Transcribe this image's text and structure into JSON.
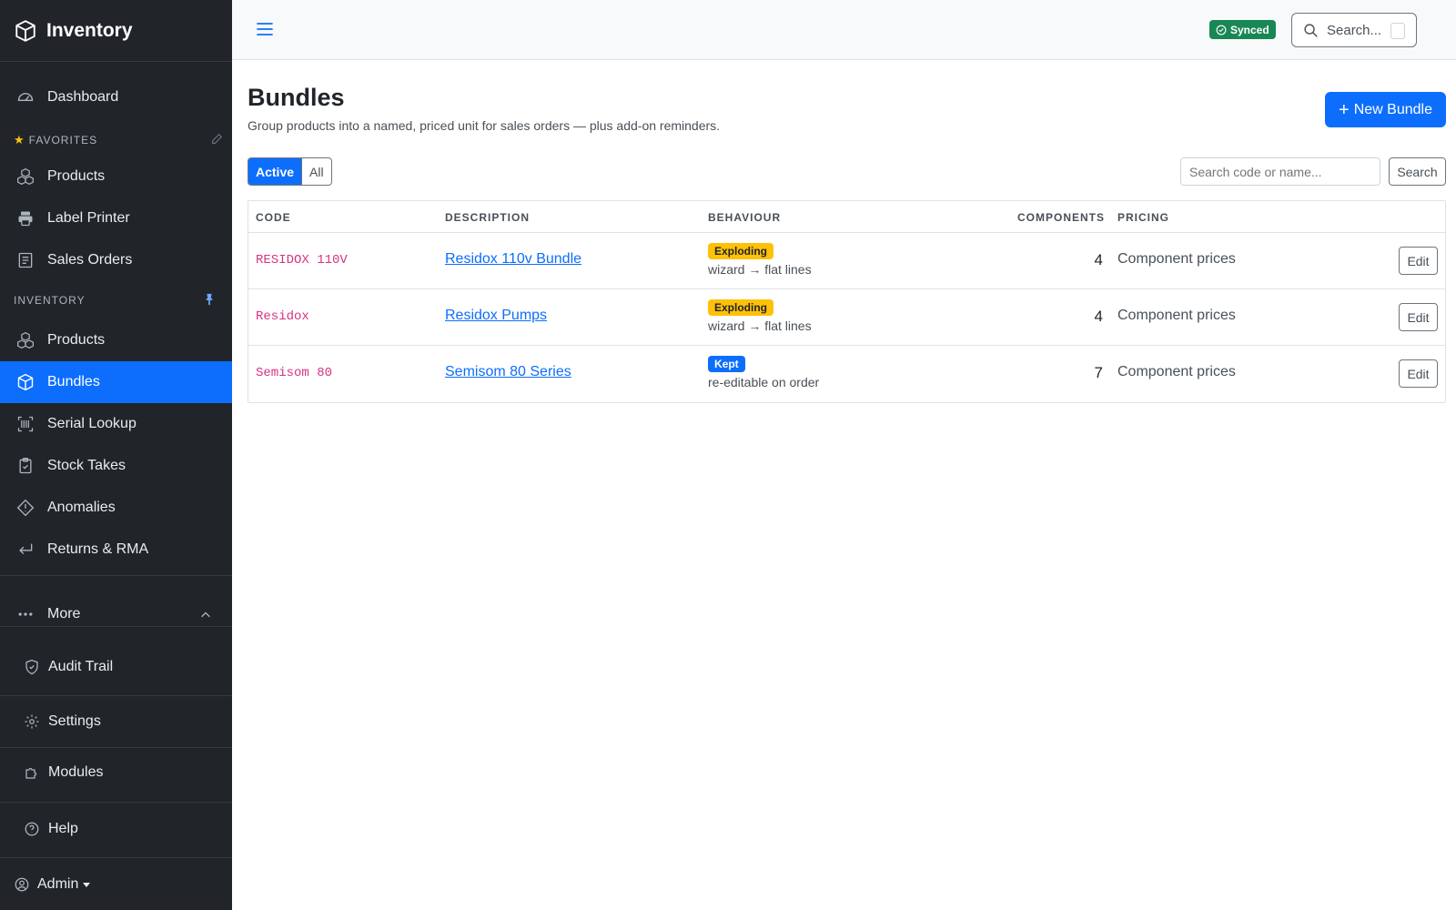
{
  "brand": {
    "title": "Inventory"
  },
  "sidebar": {
    "dashboard": "Dashboard",
    "favorites_label": "FAVORITES",
    "favorites": [
      {
        "label": "Products",
        "icon": "boxes-icon"
      },
      {
        "label": "Label Printer",
        "icon": "printer-icon"
      },
      {
        "label": "Sales Orders",
        "icon": "receipt-icon"
      }
    ],
    "inventory_label": "INVENTORY",
    "inventory": [
      {
        "label": "Products",
        "icon": "boxes-icon"
      },
      {
        "label": "Bundles",
        "icon": "box-icon",
        "active": true
      },
      {
        "label": "Serial Lookup",
        "icon": "barcode-icon"
      },
      {
        "label": "Stock Takes",
        "icon": "clipboard-check-icon"
      },
      {
        "label": "Anomalies",
        "icon": "diamond-alert-icon"
      },
      {
        "label": "Returns & RMA",
        "icon": "return-arrow-icon"
      }
    ],
    "more": "More",
    "audit_trail": "Audit Trail",
    "settings": "Settings",
    "modules": "Modules",
    "help": "Help",
    "user": "Admin"
  },
  "topbar": {
    "status": "Synced",
    "search_placeholder": "Search..."
  },
  "main": {
    "title": "Bundles",
    "subtitle": "Group products into a named, priced unit for sales orders — plus add-on reminders.",
    "new_button": "New Bundle",
    "filter": {
      "active": "Active",
      "all": "All"
    },
    "search_placeholder": "Search code or name...",
    "search_button": "Search",
    "columns": [
      "CODE",
      "DESCRIPTION",
      "BEHAVIOUR",
      "COMPONENTS",
      "PRICING"
    ],
    "rows": [
      {
        "code": "RESIDOX 110V",
        "description": "Residox 110v Bundle",
        "behaviour": "Exploding",
        "behaviour_note": "wizard → flat lines",
        "components": "4",
        "pricing": "Component prices",
        "action": "Edit"
      },
      {
        "code": "Residox",
        "description": "Residox Pumps",
        "behaviour": "Exploding",
        "behaviour_note": "wizard → flat lines",
        "components": "4",
        "pricing": "Component prices",
        "action": "Edit"
      },
      {
        "code": "Semisom 80",
        "description": "Semisom 80 Series",
        "behaviour": "Kept",
        "behaviour_note": "re-editable on order",
        "components": "7",
        "pricing": "Component prices",
        "action": "Edit"
      }
    ]
  },
  "colors": {
    "accent": "#0d6efd",
    "sidebar_bg": "#212529",
    "success": "#198754",
    "warning": "#ffc107",
    "code": "#d63384"
  }
}
